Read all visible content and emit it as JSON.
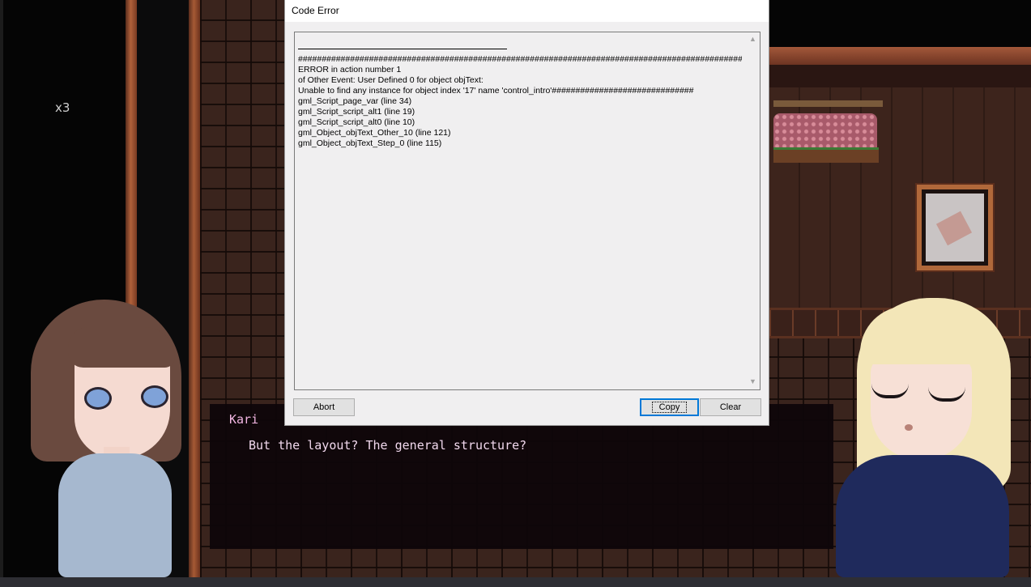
{
  "game": {
    "multiplier_label": "x3",
    "dialogue": {
      "speaker": "Kari",
      "text": "But the layout? The general structure?"
    }
  },
  "dialog": {
    "title": "Code Error",
    "error_lines": [
      "################################################################################################",
      "ERROR in action number 1",
      "of Other Event: User Defined 0 for object objText:",
      "Unable to find any instance for object index '17' name 'control_intro'##############################",
      "gml_Script_page_var (line 34)",
      "gml_Script_script_alt1 (line 19)",
      "gml_Script_script_alt0 (line 10)",
      "gml_Object_objText_Other_10 (line 121)",
      "gml_Object_objText_Step_0 (line 115)"
    ],
    "buttons": {
      "abort": "Abort",
      "copy": "Copy",
      "clear": "Clear"
    },
    "scroll_up_icon": "▲",
    "scroll_down_icon": "▼"
  },
  "colors": {
    "speaker": "#f2b6e2",
    "dialogue_text": "#f2d9ee",
    "dialogue_bg": "#0e060a",
    "dialog_bg": "#f0eff0",
    "default_button_border": "#0078d7"
  }
}
